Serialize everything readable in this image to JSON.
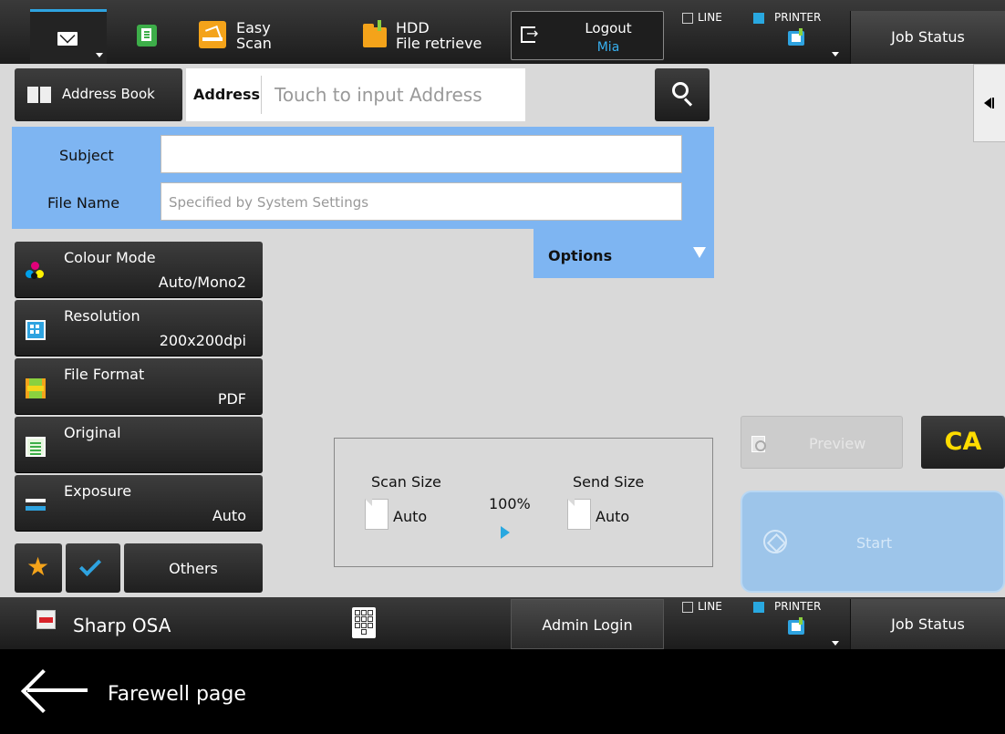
{
  "top_bar": {
    "easy_scan_line1": "Easy",
    "easy_scan_line2": "Scan",
    "hdd_line1": "HDD",
    "hdd_line2": "File retrieve",
    "logout_label": "Logout",
    "logout_user": "Mia",
    "line_label": "LINE",
    "printer_label": "PRINTER",
    "job_status_label": "Job Status"
  },
  "address": {
    "address_book_label": "Address Book",
    "address_label": "Address",
    "address_placeholder": "Touch to input Address"
  },
  "fields": {
    "subject_label": "Subject",
    "subject_value": "",
    "file_name_label": "File Name",
    "file_name_placeholder": "Specified by System Settings",
    "options_label": "Options"
  },
  "settings": [
    {
      "name": "Colour Mode",
      "value": "Auto/Mono2",
      "icon": "colour-mode-icon"
    },
    {
      "name": "Resolution",
      "value": "200x200dpi",
      "icon": "resolution-icon"
    },
    {
      "name": "File Format",
      "value": "PDF",
      "icon": "file-format-icon"
    },
    {
      "name": "Original",
      "value": "",
      "icon": "original-icon"
    },
    {
      "name": "Exposure",
      "value": "Auto",
      "icon": "exposure-icon"
    }
  ],
  "bottom_buttons": {
    "others_label": "Others"
  },
  "scan_panel": {
    "scan_size_label": "Scan Size",
    "scan_size_value": "Auto",
    "ratio": "100%",
    "send_size_label": "Send Size",
    "send_size_value": "Auto"
  },
  "actions": {
    "preview_label": "Preview",
    "ca_label": "CA",
    "start_label": "Start"
  },
  "footer": {
    "app_name": "Sharp OSA",
    "admin_login_label": "Admin Login",
    "line_label": "LINE",
    "printer_label": "PRINTER",
    "job_status_label": "Job Status"
  },
  "nav": {
    "back_label": "Farewell page"
  },
  "colors": {
    "accent_blue": "#7eb5f2",
    "ca_yellow": "#ffdc00",
    "start_blue": "#9dc5ea"
  }
}
